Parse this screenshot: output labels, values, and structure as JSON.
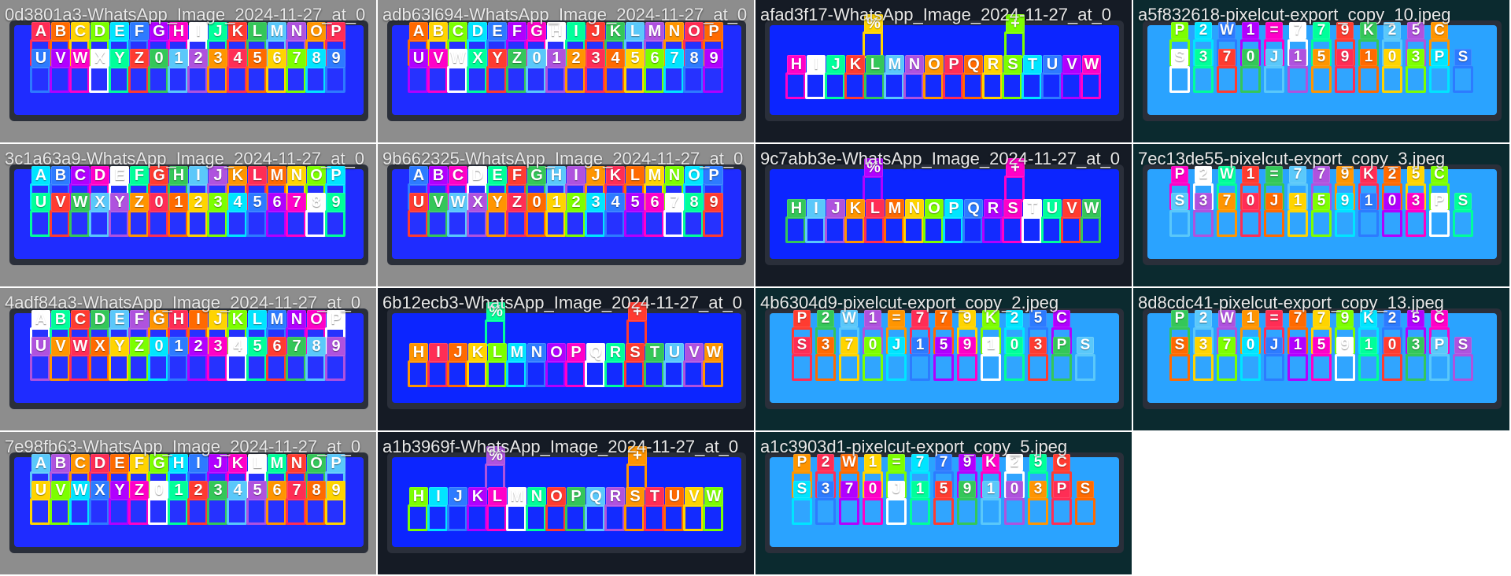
{
  "tiles": [
    {
      "title": "0d3801a3-WhatsApp_Image_2024-11-27_at_0",
      "theme": "a",
      "glyph_rows": [
        [
          "A",
          "B",
          "C",
          "D",
          "E",
          "F",
          "G",
          "H",
          "I",
          "J",
          "K",
          "L",
          "M",
          "N",
          "O",
          "P"
        ],
        [
          "U",
          "V",
          "W",
          "X",
          "Y",
          "Z",
          "0",
          "1",
          "2",
          "3",
          "4",
          "5",
          "6",
          "7",
          "8",
          "9"
        ]
      ]
    },
    {
      "title": "adb63l694-WhatsApp_Image_2024-11-27_at_0",
      "theme": "a",
      "glyph_rows": [
        [
          "A",
          "B",
          "C",
          "D",
          "E",
          "F",
          "G",
          "H",
          "I",
          "J",
          "K",
          "L",
          "M",
          "N",
          "O",
          "P"
        ],
        [
          "U",
          "V",
          "W",
          "X",
          "Y",
          "Z",
          "0",
          "1",
          "2",
          "3",
          "4",
          "5",
          "6",
          "7",
          "8",
          "9"
        ]
      ]
    },
    {
      "title": "afad3f17-WhatsApp_Image_2024-11-27_at_0",
      "theme": "b",
      "glyph_rows": [
        [
          "%",
          "+"
        ],
        [
          "H",
          "I",
          "J",
          "K",
          "L",
          "M",
          "N",
          "O",
          "P",
          "Q",
          "R",
          "S",
          "T",
          "U",
          "V",
          "W"
        ]
      ]
    },
    {
      "title": "a5f832618-pixelcut-export_copy_10.jpeg",
      "theme": "c",
      "glyph_rows": [
        [
          "P",
          "2",
          "W",
          "1",
          "=",
          "7",
          "7",
          "9",
          "K",
          "2",
          "5",
          "C"
        ],
        [
          "S",
          "3",
          "7",
          "0",
          "J",
          "1",
          "5",
          "9",
          "1",
          "0",
          "3",
          "P",
          "S"
        ]
      ]
    },
    {
      "title": "3c1a63a9-WhatsApp_Image_2024-11-27_at_0",
      "theme": "a",
      "glyph_rows": [
        [
          "A",
          "B",
          "C",
          "D",
          "E",
          "F",
          "G",
          "H",
          "I",
          "J",
          "K",
          "L",
          "M",
          "N",
          "O",
          "P"
        ],
        [
          "U",
          "V",
          "W",
          "X",
          "Y",
          "Z",
          "0",
          "1",
          "2",
          "3",
          "4",
          "5",
          "6",
          "7",
          "8",
          "9"
        ]
      ]
    },
    {
      "title": "9b662325-WhatsApp_Image_2024-11-27_at_0",
      "theme": "a",
      "glyph_rows": [
        [
          "A",
          "B",
          "C",
          "D",
          "E",
          "F",
          "G",
          "H",
          "I",
          "J",
          "K",
          "L",
          "M",
          "N",
          "O",
          "P"
        ],
        [
          "U",
          "V",
          "W",
          "X",
          "Y",
          "Z",
          "0",
          "1",
          "2",
          "3",
          "4",
          "5",
          "6",
          "7",
          "8",
          "9"
        ]
      ]
    },
    {
      "title": "9c7abb3e-WhatsApp_Image_2024-11-27_at_0",
      "theme": "b",
      "glyph_rows": [
        [
          "%",
          "+"
        ],
        [
          "H",
          "I",
          "J",
          "K",
          "L",
          "M",
          "N",
          "O",
          "P",
          "Q",
          "R",
          "S",
          "T",
          "U",
          "V",
          "W"
        ]
      ]
    },
    {
      "title": "7ec13de55-pixelcut-export_copy_3.jpeg",
      "theme": "c",
      "glyph_rows": [
        [
          "P",
          "2",
          "W",
          "1",
          "=",
          "7",
          "7",
          "9",
          "K",
          "2",
          "5",
          "C"
        ],
        [
          "S",
          "3",
          "7",
          "0",
          "J",
          "1",
          "5",
          "9",
          "1",
          "0",
          "3",
          "P",
          "S"
        ]
      ]
    },
    {
      "title": "4adf84a3-WhatsApp_Image_2024-11-27_at_0",
      "theme": "a",
      "glyph_rows": [
        [
          "A",
          "B",
          "C",
          "D",
          "E",
          "F",
          "G",
          "H",
          "I",
          "J",
          "K",
          "L",
          "M",
          "N",
          "O",
          "P"
        ],
        [
          "U",
          "V",
          "W",
          "X",
          "Y",
          "Z",
          "0",
          "1",
          "2",
          "3",
          "4",
          "5",
          "6",
          "7",
          "8",
          "9"
        ]
      ]
    },
    {
      "title": "6b12ecb3-WhatsApp_Image_2024-11-27_at_0",
      "theme": "b",
      "glyph_rows": [
        [
          "%",
          "+"
        ],
        [
          "H",
          "I",
          "J",
          "K",
          "L",
          "M",
          "N",
          "O",
          "P",
          "Q",
          "R",
          "S",
          "T",
          "U",
          "V",
          "W"
        ]
      ]
    },
    {
      "title": "4b6304d9-pixelcut-export_copy_2.jpeg",
      "theme": "c",
      "glyph_rows": [
        [
          "P",
          "2",
          "W",
          "1",
          "=",
          "7",
          "7",
          "9",
          "K",
          "2",
          "5",
          "C"
        ],
        [
          "S",
          "3",
          "7",
          "0",
          "J",
          "1",
          "5",
          "9",
          "1",
          "0",
          "3",
          "P",
          "S"
        ]
      ]
    },
    {
      "title": "8d8cdc41-pixelcut-export_copy_13.jpeg",
      "theme": "c",
      "glyph_rows": [
        [
          "P",
          "2",
          "W",
          "1",
          "=",
          "7",
          "7",
          "9",
          "K",
          "2",
          "5",
          "C"
        ],
        [
          "S",
          "3",
          "7",
          "0",
          "J",
          "1",
          "5",
          "9",
          "1",
          "0",
          "3",
          "P",
          "S"
        ]
      ]
    },
    {
      "title": "7e98fb63-WhatsApp_Image_2024-11-27_at_0",
      "theme": "a",
      "glyph_rows": [
        [
          "A",
          "B",
          "C",
          "D",
          "E",
          "F",
          "G",
          "H",
          "I",
          "J",
          "K",
          "L",
          "M",
          "N",
          "O",
          "P"
        ],
        [
          "U",
          "V",
          "W",
          "X",
          "Y",
          "Z",
          "0",
          "1",
          "2",
          "3",
          "4",
          "5",
          "6",
          "7",
          "8",
          "9"
        ]
      ]
    },
    {
      "title": "a1b3969f-WhatsApp_Image_2024-11-27_at_0",
      "theme": "b",
      "glyph_rows": [
        [
          "%",
          "+"
        ],
        [
          "H",
          "I",
          "J",
          "K",
          "L",
          "M",
          "N",
          "O",
          "P",
          "Q",
          "R",
          "S",
          "T",
          "U",
          "V",
          "W"
        ]
      ]
    },
    {
      "title": "a1c3903d1-pixelcut-export_copy_5.jpeg",
      "theme": "c",
      "glyph_rows": [
        [
          "P",
          "2",
          "W",
          "1",
          "=",
          "7",
          "7",
          "9",
          "K",
          "2",
          "5",
          "C"
        ],
        [
          "S",
          "3",
          "7",
          "0",
          "J",
          "1",
          "5",
          "9",
          "1",
          "0",
          "3",
          "P",
          "S"
        ]
      ]
    },
    {
      "title": "",
      "theme": "empty",
      "glyph_rows": []
    }
  ],
  "palette": [
    "#ff2d55",
    "#ff6a00",
    "#ffd400",
    "#7cff00",
    "#00e5ff",
    "#2d7bff",
    "#b100ff",
    "#ff00c8",
    "#ffffff",
    "#00ff9a",
    "#ff3b30",
    "#34c759",
    "#5ac8fa",
    "#af52de",
    "#ff9500"
  ]
}
